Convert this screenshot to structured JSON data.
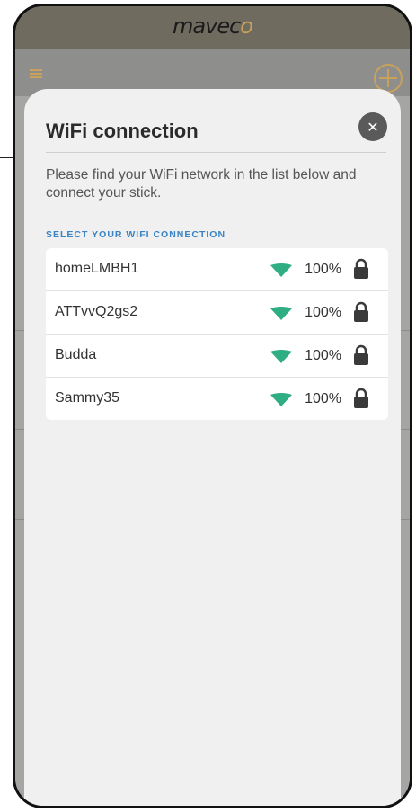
{
  "header": {
    "logo_main": "mavec",
    "logo_accent": "o"
  },
  "dialog": {
    "title": "WiFi connection",
    "close_icon": "close-icon",
    "description": "Please find your WiFi network in the list below and connect your stick.",
    "section_label": "SELECT YOUR WIFI CONNECTION",
    "networks": [
      {
        "ssid": "homeLMBH1",
        "signal": "100%"
      },
      {
        "ssid": "ATTvvQ2gs2",
        "signal": "100%"
      },
      {
        "ssid": "Budda",
        "signal": "100%"
      },
      {
        "ssid": "Sammy35",
        "signal": "100%"
      }
    ]
  },
  "colors": {
    "accent": "#c9a15b",
    "wifi": "#2fae84",
    "label": "#3a83c4"
  },
  "icons": [
    "menu-icon",
    "add-icon",
    "close-icon",
    "wifi-signal-icon",
    "lock-icon"
  ]
}
